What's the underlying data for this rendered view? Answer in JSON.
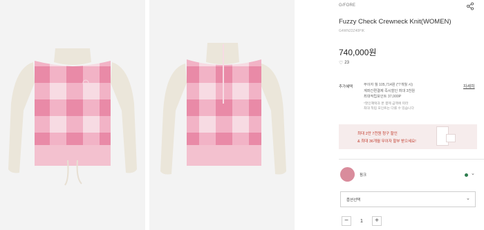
{
  "product": {
    "brand": "G/FORE",
    "title": "Fuzzy Check Crewneck Knit(WOMEN)",
    "code": "G4WN22Z40PIK",
    "price": "740,000원",
    "likes": "23"
  },
  "benefits": {
    "label": "추가혜택",
    "line1": "무이자 월 105,714원 (*7개월 시)",
    "line2": "계좌간편결제 즉시할인 최대 3천원",
    "line3": "최대적립포인트 37,000P",
    "note1": "*할인혜택과 본 결제 금액에 따라",
    "note2": "최대 적립 포인트는 다를 수 있습니다",
    "detail_link": "자세히"
  },
  "banner": {
    "line1": "최대 2만 7천원 청구 할인",
    "line2": "& 최대 36개월 무이자 할부 받으세요!"
  },
  "color": {
    "name": "핑크",
    "swatch": "#d98c9c",
    "stock_dot": "#2e7d4f",
    "chevron": "⌄"
  },
  "option": {
    "label": "옵션선택",
    "chevron": "⌄"
  },
  "quantity": {
    "minus": "−",
    "value": "1",
    "plus": "+"
  },
  "icons": {
    "share": "share-icon",
    "heart": "heart-icon"
  },
  "colors": {
    "pink_dark": "#e88aa6",
    "pink_light": "#f6c8d6",
    "cream": "#ebe6da",
    "accent_red": "#c0392b"
  }
}
